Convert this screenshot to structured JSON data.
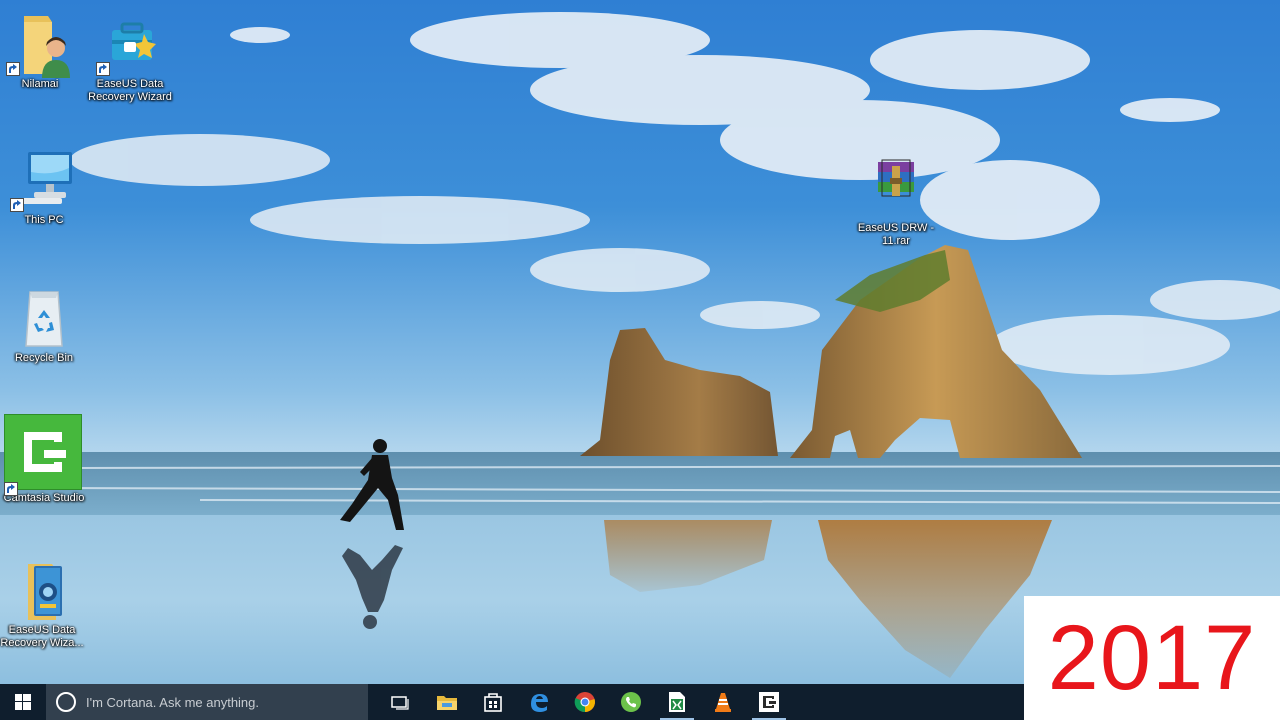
{
  "desktop": {
    "icons": [
      {
        "label": "Nilamai",
        "icon": "user-folder-icon"
      },
      {
        "label": "EaseUS Data Recovery Wizard",
        "icon": "toolbox-icon"
      },
      {
        "label": "This PC",
        "icon": "computer-icon"
      },
      {
        "label": "Recycle Bin",
        "icon": "recycle-bin-icon"
      },
      {
        "label": "Camtasia Studio",
        "icon": "camtasia-icon"
      },
      {
        "label": "EaseUS Data Recovery Wiza...",
        "icon": "installer-box-icon"
      },
      {
        "label": "EaseUS DRW - 11.rar",
        "icon": "winrar-archive-icon"
      }
    ]
  },
  "overlay": {
    "year": "2017",
    "color": "#e8161b"
  },
  "taskbar": {
    "search_placeholder": "I'm Cortana. Ask me anything.",
    "pinned": [
      {
        "name": "task-view",
        "icon": "task-view-icon"
      },
      {
        "name": "file-explorer",
        "icon": "folder-icon"
      },
      {
        "name": "store",
        "icon": "store-bag-icon"
      },
      {
        "name": "edge",
        "icon": "edge-icon"
      },
      {
        "name": "chrome",
        "icon": "chrome-icon"
      },
      {
        "name": "viber",
        "icon": "phone-icon"
      },
      {
        "name": "excel",
        "icon": "spreadsheet-icon"
      },
      {
        "name": "vlc",
        "icon": "traffic-cone-icon"
      },
      {
        "name": "camtasia",
        "icon": "camtasia-icon"
      }
    ]
  }
}
